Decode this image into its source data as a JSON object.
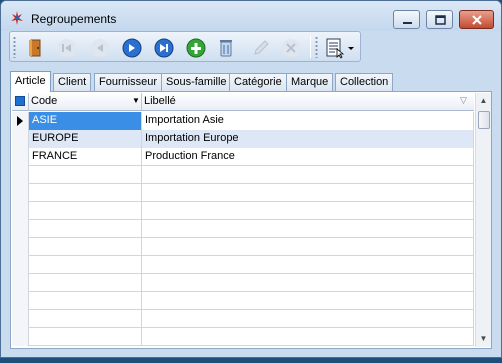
{
  "window": {
    "title": "Regroupements",
    "controls": [
      "minimize",
      "maximize",
      "close"
    ]
  },
  "toolbar": {
    "buttons": [
      {
        "name": "exit-icon",
        "enabled": true
      },
      {
        "name": "first-record-icon",
        "enabled": false
      },
      {
        "name": "previous-record-icon",
        "enabled": false
      },
      {
        "name": "next-record-icon",
        "enabled": true
      },
      {
        "name": "last-record-icon",
        "enabled": true
      },
      {
        "name": "add-record-icon",
        "enabled": true
      },
      {
        "name": "delete-record-icon",
        "enabled": true
      },
      {
        "name": "edit-record-icon",
        "enabled": false
      },
      {
        "name": "cancel-record-icon",
        "enabled": false
      },
      {
        "name": "report-menu-icon",
        "enabled": true
      }
    ]
  },
  "tabs": [
    {
      "label": "Article",
      "active": true
    },
    {
      "label": "Client",
      "active": false
    },
    {
      "label": "Fournisseur",
      "active": false
    },
    {
      "label": "Sous-famille",
      "active": false
    },
    {
      "label": "Catégorie",
      "active": false
    },
    {
      "label": "Marque",
      "active": false
    },
    {
      "label": "Collection",
      "active": false
    }
  ],
  "grid": {
    "columns": {
      "code": "Code",
      "libelle": "Libellé"
    },
    "rows": [
      {
        "code": "ASIE",
        "libelle": "Importation Asie"
      },
      {
        "code": "EUROPE",
        "libelle": "Importation Europe"
      },
      {
        "code": "FRANCE",
        "libelle": "Production France"
      }
    ],
    "current_row": 0,
    "empty_rows": 10
  },
  "colors": {
    "selection": "#3a8ee6",
    "alt_row": "#dde7f6",
    "window_bg": "#c9dcef"
  }
}
